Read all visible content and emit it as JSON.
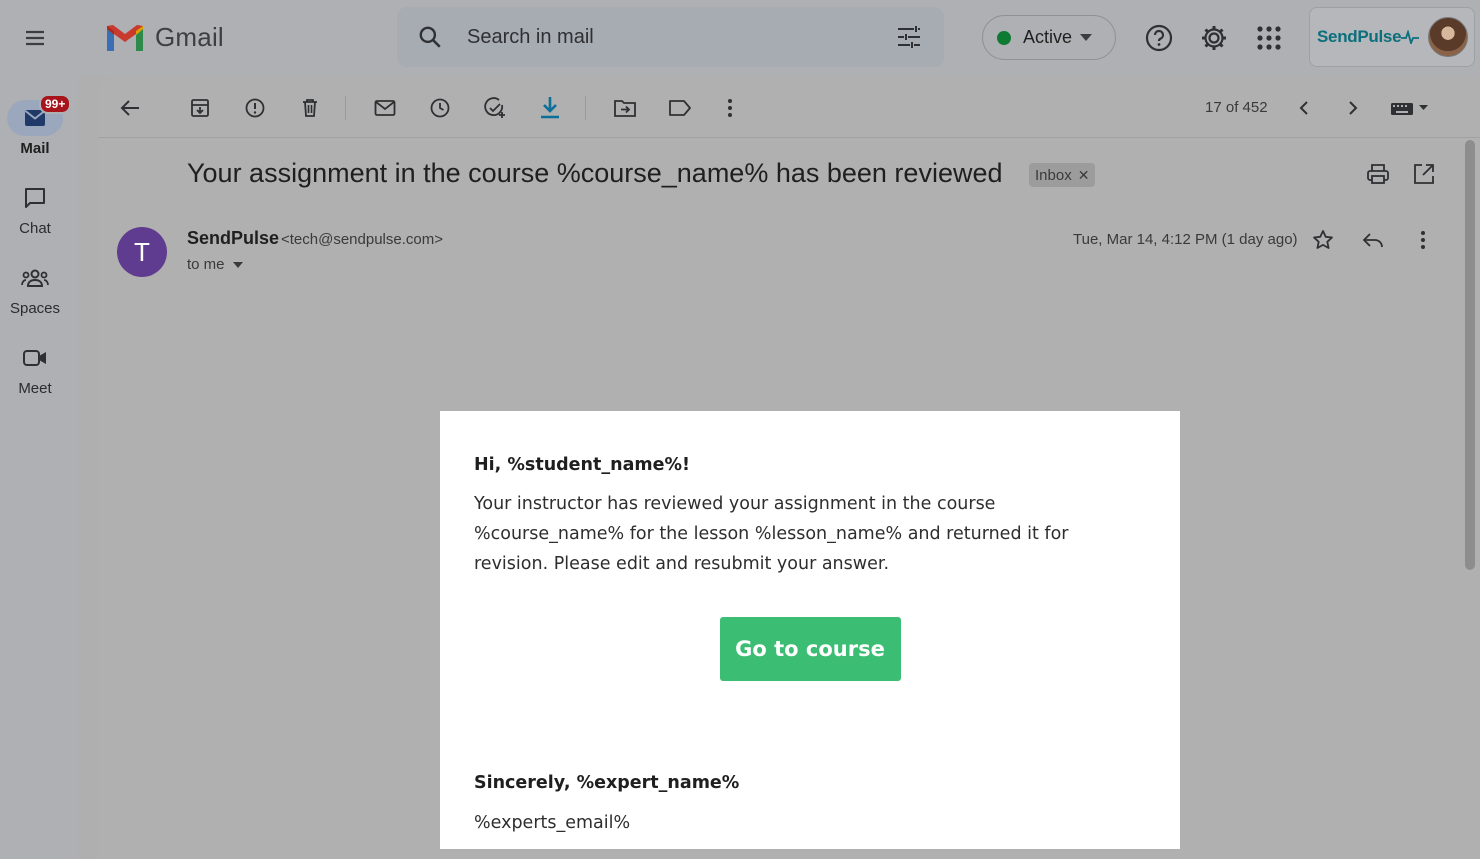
{
  "app": {
    "name": "Gmail"
  },
  "search": {
    "placeholder": "Search in mail"
  },
  "status": {
    "label": "Active",
    "color": "#0f7b32"
  },
  "account": {
    "brand": "SendPulse"
  },
  "rail": {
    "items": [
      {
        "label": "Mail",
        "badge": "99+"
      },
      {
        "label": "Chat"
      },
      {
        "label": "Spaces"
      },
      {
        "label": "Meet"
      }
    ]
  },
  "toolbar": {
    "pager": "17 of 452"
  },
  "message": {
    "subject": "Your assignment in the course %course_name% has been reviewed",
    "label_chip": "Inbox",
    "sender_initial": "T",
    "sender_name": "SendPulse",
    "sender_email": "<tech@sendpulse.com>",
    "recipient": "to me",
    "date": "Tue, Mar 14, 4:12 PM (1 day ago)",
    "sender_avatar_color": "#5f3c8f"
  },
  "email_body": {
    "greeting": "Hi, %student_name%!",
    "text": "Your instructor has reviewed your assignment in the course %course_name% for the lesson %lesson_name% and returned it for revision. Please edit and resubmit your answer.",
    "button_label": "Go to course",
    "button_color": "#3cbd74",
    "signoff": "Sincerely, %expert_name%",
    "expert_email": "%experts_email%"
  }
}
